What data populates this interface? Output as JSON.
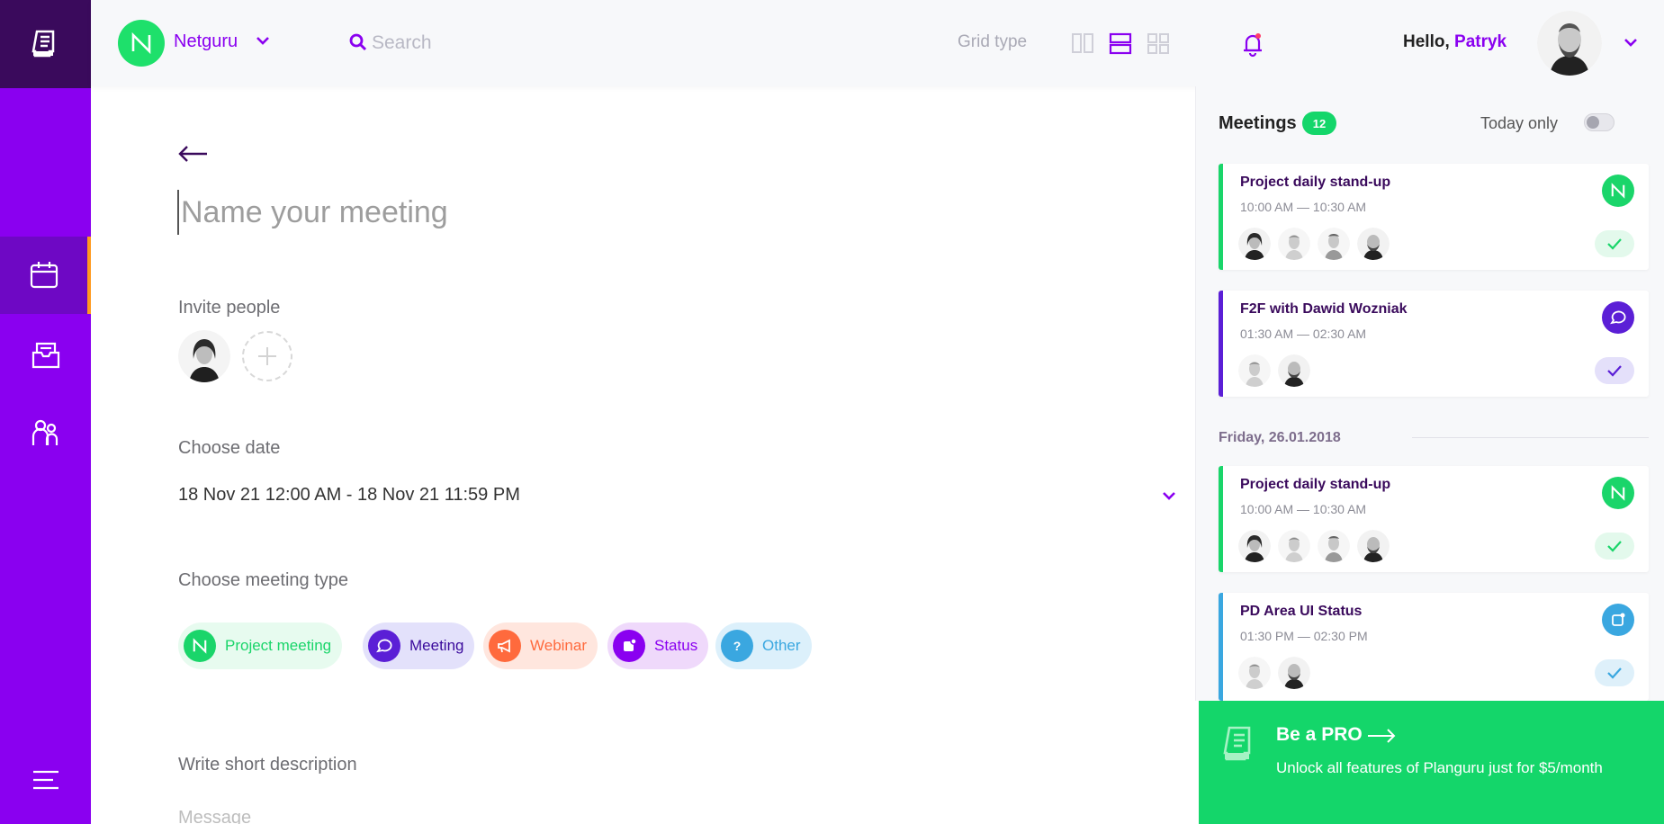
{
  "topbar": {
    "workspace_name": "Netguru",
    "search_placeholder": "Search",
    "grid_type_label": "Grid type",
    "greeting": "Hello,",
    "user_name": "Patryk"
  },
  "sidebar": {
    "items": [
      {
        "name": "logo",
        "icon": "document-icon"
      },
      {
        "name": "calendar",
        "icon": "calendar-icon",
        "active": true
      },
      {
        "name": "inbox",
        "icon": "inbox-icon"
      },
      {
        "name": "people",
        "icon": "people-icon"
      },
      {
        "name": "menu",
        "icon": "hamburger-menu-icon"
      }
    ]
  },
  "form": {
    "name_placeholder": "Name your meeting",
    "invite_label": "Invite people",
    "date_label": "Choose date",
    "date_value": "18 Nov 21 12:00 AM - 18 Nov 21 11:59 PM",
    "type_label": "Choose meeting type",
    "types": [
      {
        "label": "Project meeting",
        "color": "#1ad56a"
      },
      {
        "label": "Meeting",
        "color": "#5b1fd6"
      },
      {
        "label": "Webinar",
        "color": "#ff6a3d"
      },
      {
        "label": "Status",
        "color": "#8a00f0"
      },
      {
        "label": "Other",
        "color": "#3aa7e0"
      }
    ],
    "description_label": "Write short description",
    "message_placeholder": "Message"
  },
  "panel": {
    "title": "Meetings",
    "count": "12",
    "today_only_label": "Today only",
    "today_only": false,
    "day_heading": "Friday, 26.01.2018",
    "meetings": [
      {
        "title": "Project daily stand-up",
        "time": "10:00 AM — 10:30 AM",
        "type": "project",
        "people": 4
      },
      {
        "title": "F2F with Dawid Wozniak",
        "time": "01:30 AM — 02:30 AM",
        "type": "meeting",
        "people": 2
      },
      {
        "title": "Project daily stand-up",
        "time": "10:00 AM — 10:30 AM",
        "type": "project",
        "people": 4
      },
      {
        "title": "PD Area UI Status",
        "time": "01:30 PM — 02:30 PM",
        "type": "status",
        "people": 2
      }
    ]
  },
  "pro": {
    "title": "Be a PRO",
    "text": "Unlock all features of Planguru just for $5/month"
  },
  "colors": {
    "sidebar": "#8a00f0",
    "sidebar_dark": "#3a0a5c",
    "accent_orange": "#ff9a1f",
    "green": "#14d66a",
    "purple": "#8a00f0"
  }
}
